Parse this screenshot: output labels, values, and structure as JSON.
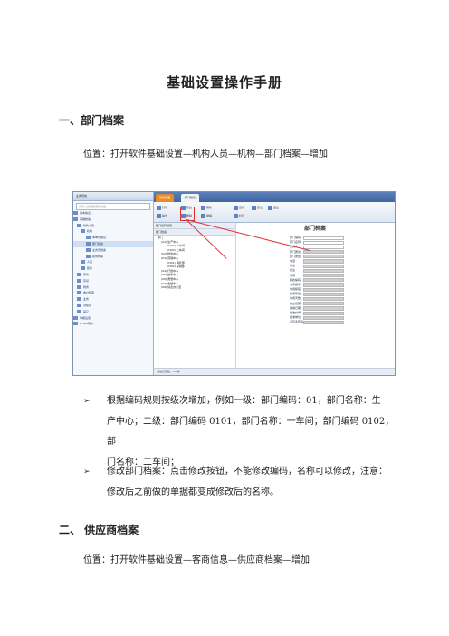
{
  "doc": {
    "title": "基础设置操作手册",
    "sections": [
      {
        "heading": "一、部门档案",
        "location": "位置：打开软件基础设置—机构人员—机构—部门档案—增加"
      },
      {
        "heading": "二、 供应商档案",
        "location": "位置：打开软件基础设置—客商信息—供应商档案—增加"
      }
    ],
    "bullets": [
      {
        "lines": [
          "根据编码规则按级次增加，例如一级：部门编码：01，部门名称：生",
          "产中心；二级：部门编码 0101，部门名称：一车间；部门编码 0102，部",
          "门名称：二车间；"
        ]
      },
      {
        "lines": [
          "修改部门档案：点击修改按钮，不能修改编码，名称可以修改，注意：",
          "修改后之前做的单据都变成修改后的名称。"
        ]
      }
    ],
    "bullet_mark": "➢"
  },
  "screenshot": {
    "nav_title": "业务导航",
    "search_placeholder": "请输入您要搜索的功能",
    "tree": [
      "基本信息",
      "基础档案",
      "机构人员",
      "机构",
      "本单位信息",
      "部门档案",
      "业务员档案",
      "职务档案",
      "人员",
      "职务",
      "客商",
      "存货",
      "财务",
      "收付结算",
      "业务",
      "对照表",
      "其它",
      "单据设置",
      "UFIDA软件"
    ],
    "tabs": [
      "简易桌面",
      "部门档案"
    ],
    "ribbon": [
      "打印",
      "修改",
      "删除",
      "刷新",
      "撤销",
      "输出",
      "查询",
      "定位",
      "退出",
      "栏目"
    ],
    "left_head": "部门编码规则",
    "left_sub": "部门档案",
    "left_tree": [
      "部门",
      "(01) 生产中心",
      "(0101) 一车间",
      "(0102) 二车间",
      "(02) 财务中心",
      "(03) 营销中心",
      "(0301) 销售部",
      "(0302) 采购部",
      "(04) 行政中心",
      "(05) 技术中心",
      "(06) 质量中心",
      "(07) 仓储中心",
      "(08) 综合办公室"
    ],
    "form_title": "部门档案",
    "form_fields": [
      "部门编码",
      "部门名称",
      "负责人",
      "部门属性",
      "部门类型",
      "电话",
      "地址",
      "备注",
      "传真",
      "邮政编码",
      "电子邮件",
      "信用额度",
      "信用等级",
      "信用天数",
      "成立日期",
      "撤销日期",
      "批准文号",
      "批准单位",
      "对应条形码"
    ],
    "status": "当前记录数：13 条"
  }
}
